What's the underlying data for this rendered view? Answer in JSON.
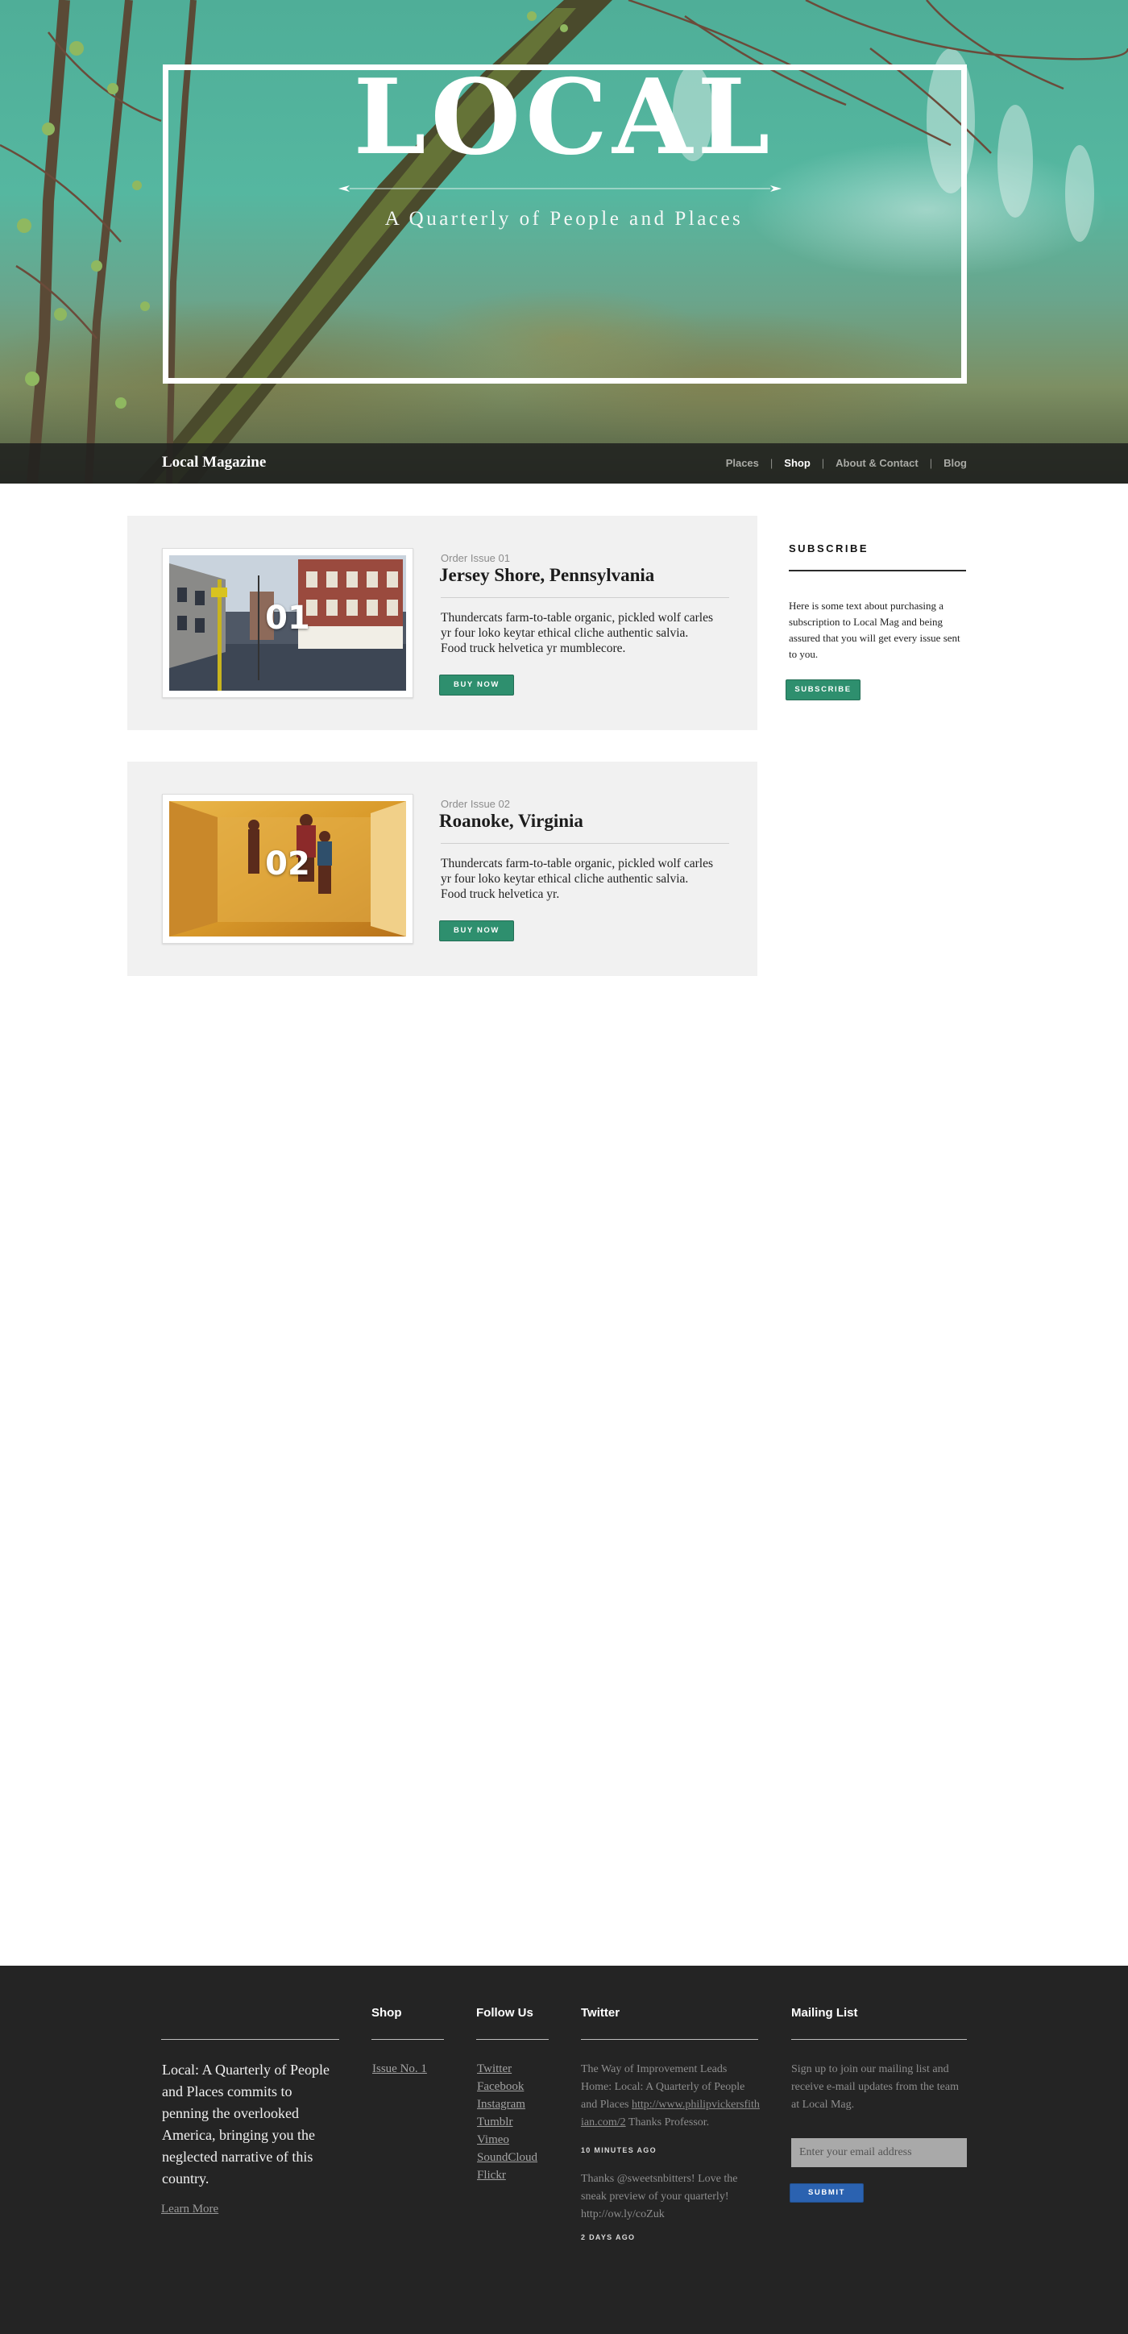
{
  "hero": {
    "title": "LOCAL",
    "subtitle": "A Quarterly of People and Places"
  },
  "nav": {
    "brand": "Local Magazine",
    "items": [
      {
        "label": "Places",
        "active": false
      },
      {
        "label": "Shop",
        "active": true
      },
      {
        "label": "About & Contact",
        "active": false
      },
      {
        "label": "Blog",
        "active": false
      }
    ],
    "separator": "|"
  },
  "products": [
    {
      "number": "01",
      "order_label": "Order Issue 01",
      "title": "Jersey Shore, Pennsylvania",
      "description": "Thundercats farm-to-table organic, pickled wolf carles yr four loko keytar ethical cliche authentic salvia. Food truck helvetica yr mumblecore.",
      "button": "BUY NOW"
    },
    {
      "number": "02",
      "order_label": "Order Issue 02",
      "title": "Roanoke, Virginia",
      "description": "Thundercats farm-to-table organic, pickled wolf carles yr four loko keytar ethical cliche authentic salvia. Food truck helvetica yr.",
      "button": "BUY NOW"
    }
  ],
  "sidebar": {
    "heading": "SUBSCRIBE",
    "text": "Here is some text about purchasing a subscription to Local Mag and being assured that you will get every issue sent to you.",
    "button": "SUBSCRIBE"
  },
  "footer": {
    "about": {
      "text": "Local: A Quarterly of People and Places commits to penning the overlooked America, bringing you the neglected  narrative of this country.",
      "learn_more": "Learn More"
    },
    "shop": {
      "heading": "Shop",
      "links": [
        "Issue No. 1"
      ]
    },
    "follow": {
      "heading": "Follow Us",
      "links": [
        "Twitter",
        "Facebook",
        "Instagram",
        "Tumblr",
        "Vimeo",
        "SoundCloud",
        "Flickr"
      ]
    },
    "twitter": {
      "heading": "Twitter",
      "tweets": [
        {
          "text_before": "The Way of Improvement Leads Home: Local: A Quarterly of People and Places ",
          "link": "http://www.philipvickersfithian.com/2",
          "text_after": " Thanks Professor.",
          "time": "10 MINUTES AGO"
        },
        {
          "text_before": "Thanks @sweetsnbitters! Love the sneak preview of your quarterly! http://ow.ly/coZuk",
          "link": "",
          "text_after": "",
          "time": "2 DAYS AGO"
        }
      ]
    },
    "mailing": {
      "heading": "Mailing List",
      "text": "Sign up to join our mailing list and receive e-mail updates from the team at Local Mag.",
      "placeholder": "Enter your email address",
      "button": "SUBMIT"
    }
  },
  "colors": {
    "accent_green": "#2e8f6e",
    "submit_blue": "#2b62b0",
    "footer_bg": "#242424",
    "card_bg": "#f1f1f1"
  }
}
